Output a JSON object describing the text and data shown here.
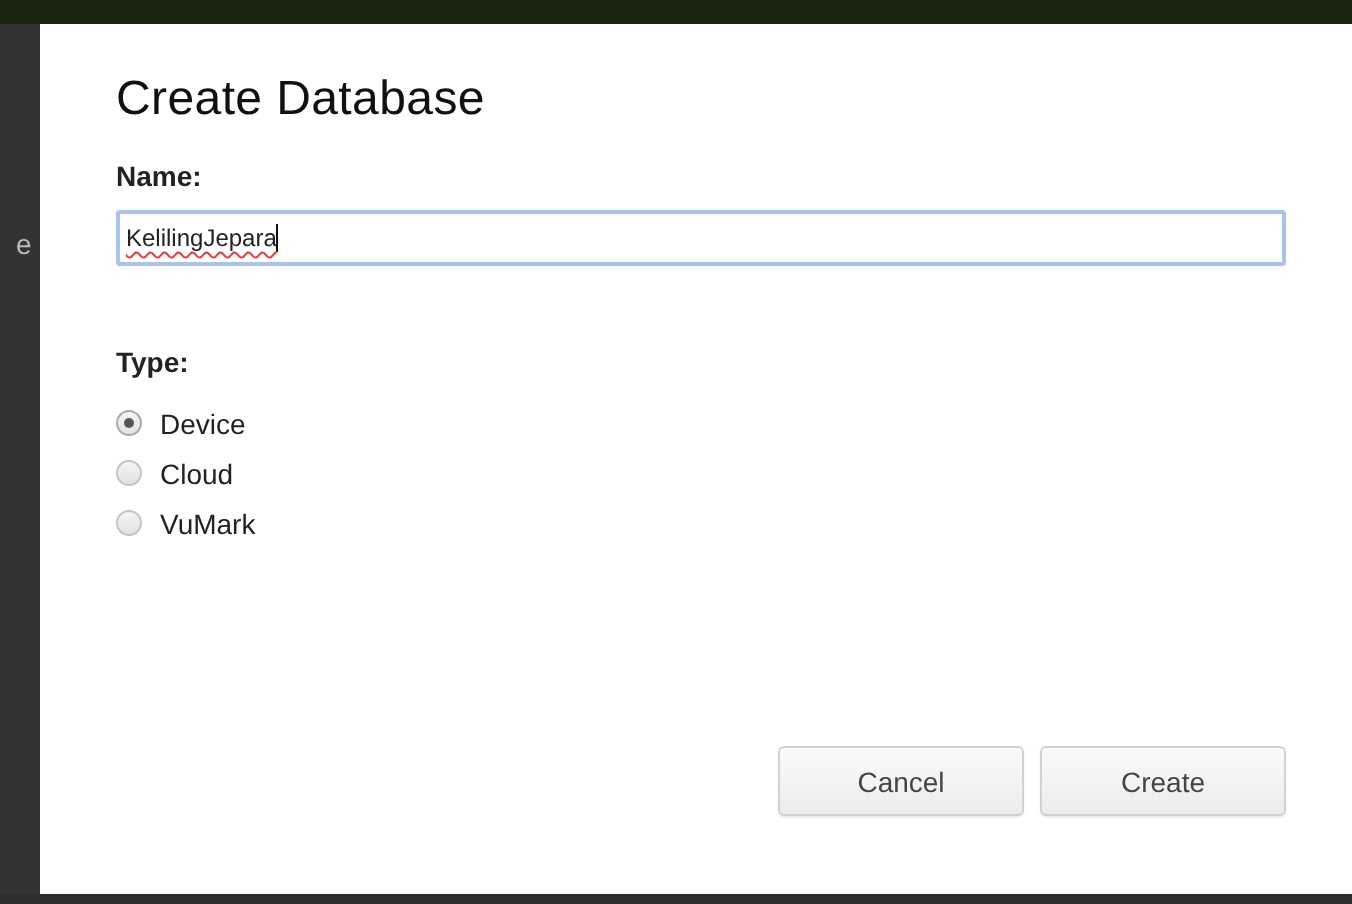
{
  "background": {
    "side_text": "e"
  },
  "dialog": {
    "title": "Create Database",
    "name_label": "Name:",
    "name_field": {
      "value": "KelilingJepara",
      "focused": true
    },
    "type_label": "Type:",
    "types": [
      {
        "label": "Device",
        "selected": true
      },
      {
        "label": "Cloud",
        "selected": false
      },
      {
        "label": "VuMark",
        "selected": false
      }
    ],
    "buttons": [
      {
        "label": "Cancel"
      },
      {
        "label": "Create"
      }
    ]
  }
}
